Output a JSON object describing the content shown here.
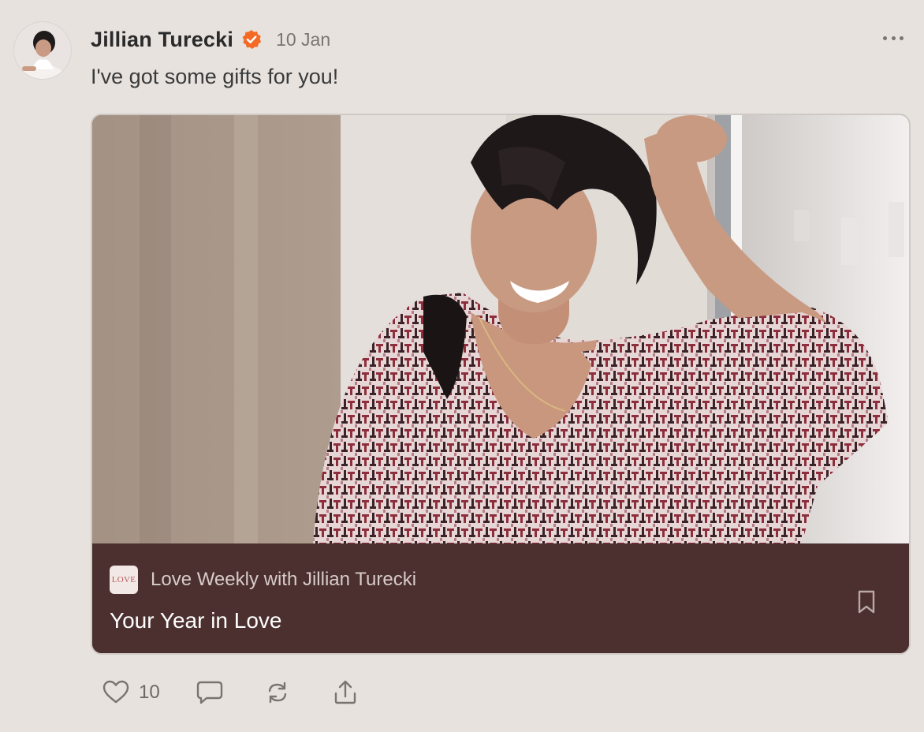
{
  "post": {
    "author": "Jillian Turecki",
    "date": "10 Jan",
    "text": "I've got some gifts for you!",
    "avatar_icon": "avatar-photo",
    "verified_icon": "verified-badge-icon",
    "verified_color": "#f46a25"
  },
  "card": {
    "publication_logo_text": "LOVE",
    "publication_name": "Love Weekly with Jillian Turecki",
    "title": "Your Year in Love",
    "footer_color": "#4b302f",
    "bookmark_icon": "bookmark-icon"
  },
  "actions": {
    "like_icon": "heart-icon",
    "like_count": "10",
    "comment_icon": "comment-icon",
    "restack_icon": "restack-icon",
    "share_icon": "share-icon"
  },
  "colors": {
    "background": "#e7e2de",
    "accent": "#f46a25"
  }
}
